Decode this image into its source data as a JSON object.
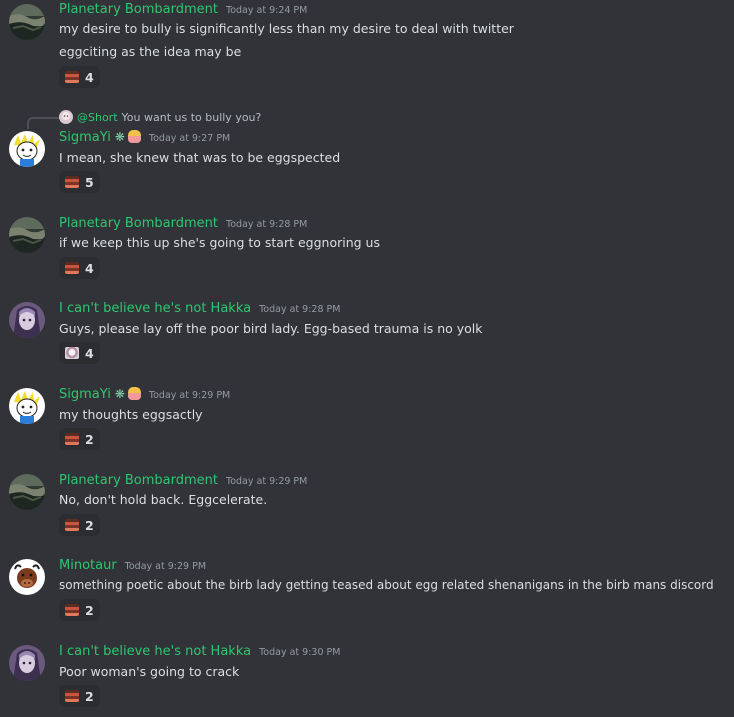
{
  "messages": [
    {
      "author": "Planetary Bombardment",
      "timestamp": "Today at 9:24 PM",
      "avatar": "planet-terrain",
      "lines": [
        "my desire to bully is significantly less than my desire to deal with twitter",
        "eggciting as the idea may be"
      ],
      "reaction": {
        "emoji": "egg-reaction",
        "count": "4"
      }
    },
    {
      "author": "SigmaYi",
      "badges": [
        "flower",
        "person"
      ],
      "timestamp": "Today at 9:27 PM",
      "avatar": "cartoon-face",
      "reply": {
        "author": "@Short",
        "text": "You want us to bully you?"
      },
      "lines": [
        "I mean, she knew that was to be eggspected"
      ],
      "reaction": {
        "emoji": "egg-reaction",
        "count": "5"
      }
    },
    {
      "author": "Planetary Bombardment",
      "timestamp": "Today at 9:28 PM",
      "avatar": "planet-terrain",
      "lines": [
        "if we keep this up she's going to start eggnoring us"
      ],
      "reaction": {
        "emoji": "egg-reaction",
        "count": "4"
      }
    },
    {
      "author": "I can't believe he's not Hakka",
      "timestamp": "Today at 9:28 PM",
      "avatar": "purple-character",
      "lines": [
        "Guys, please lay off the poor bird lady. Egg-based trauma is no yolk"
      ],
      "reaction": {
        "emoji": "bird-reaction",
        "count": "4"
      }
    },
    {
      "author": "SigmaYi",
      "badges": [
        "flower",
        "person"
      ],
      "timestamp": "Today at 9:29 PM",
      "avatar": "cartoon-face",
      "lines": [
        "my thoughts eggsactly"
      ],
      "reaction": {
        "emoji": "egg-reaction",
        "count": "2"
      }
    },
    {
      "author": "Planetary Bombardment",
      "timestamp": "Today at 9:29 PM",
      "avatar": "planet-terrain",
      "lines": [
        "No, don't hold back. Eggcelerate."
      ],
      "reaction": {
        "emoji": "egg-reaction",
        "count": "2"
      }
    },
    {
      "author": "Minotaur",
      "timestamp": "Today at 9:29 PM",
      "avatar": "minotaur-icon",
      "lines": [
        "something poetic about the birb lady getting teased about egg related shenanigans in the birb mans discord"
      ],
      "reaction": {
        "emoji": "egg-reaction",
        "count": "2"
      }
    },
    {
      "author": "I can't believe he's not Hakka",
      "timestamp": "Today at 9:30 PM",
      "avatar": "purple-character",
      "lines": [
        "Poor woman's going to crack"
      ],
      "reaction": {
        "emoji": "egg-reaction",
        "count": "2"
      }
    }
  ],
  "colors": {
    "background": "#313338",
    "username": "#2dc770",
    "text": "#dbdee1",
    "timestamp": "#949ba4",
    "reaction_bg": "#2b2d31"
  }
}
